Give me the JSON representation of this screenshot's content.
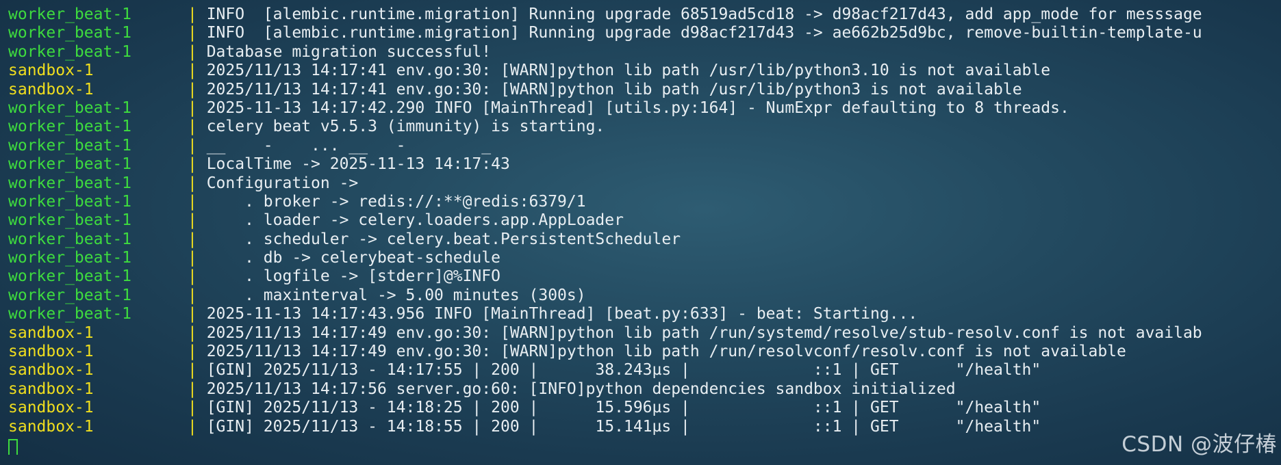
{
  "colors": {
    "worker_beat": "#3edc3e",
    "sandbox": "#f0de1e",
    "separator": "#f0de1e",
    "text": "#e8eef2"
  },
  "separator": "|",
  "lines": [
    {
      "service": "worker_beat-1",
      "color": "green",
      "text": "INFO  [alembic.runtime.migration] Running upgrade 68519ad5cd18 -> d98acf217d43, add app_mode for messsage"
    },
    {
      "service": "worker_beat-1",
      "color": "green",
      "text": "INFO  [alembic.runtime.migration] Running upgrade d98acf217d43 -> ae662b25d9bc, remove-builtin-template-u"
    },
    {
      "service": "worker_beat-1",
      "color": "green",
      "text": "Database migration successful!"
    },
    {
      "service": "sandbox-1",
      "color": "yellow",
      "text": "2025/11/13 14:17:41 env.go:30: [WARN]python lib path /usr/lib/python3.10 is not available"
    },
    {
      "service": "sandbox-1",
      "color": "yellow",
      "text": "2025/11/13 14:17:41 env.go:30: [WARN]python lib path /usr/lib/python3 is not available"
    },
    {
      "service": "worker_beat-1",
      "color": "green",
      "text": "2025-11-13 14:17:42.290 INFO [MainThread] [utils.py:164] - NumExpr defaulting to 8 threads."
    },
    {
      "service": "worker_beat-1",
      "color": "green",
      "text": "celery beat v5.5.3 (immunity) is starting."
    },
    {
      "service": "worker_beat-1",
      "color": "green",
      "text": "__    -    ... __   -        _"
    },
    {
      "service": "worker_beat-1",
      "color": "green",
      "text": "LocalTime -> 2025-11-13 14:17:43"
    },
    {
      "service": "worker_beat-1",
      "color": "green",
      "text": "Configuration ->"
    },
    {
      "service": "worker_beat-1",
      "color": "green",
      "text": "    . broker -> redis://:**@redis:6379/1"
    },
    {
      "service": "worker_beat-1",
      "color": "green",
      "text": "    . loader -> celery.loaders.app.AppLoader"
    },
    {
      "service": "worker_beat-1",
      "color": "green",
      "text": "    . scheduler -> celery.beat.PersistentScheduler"
    },
    {
      "service": "worker_beat-1",
      "color": "green",
      "text": "    . db -> celerybeat-schedule"
    },
    {
      "service": "worker_beat-1",
      "color": "green",
      "text": "    . logfile -> [stderr]@%INFO"
    },
    {
      "service": "worker_beat-1",
      "color": "green",
      "text": "    . maxinterval -> 5.00 minutes (300s)"
    },
    {
      "service": "worker_beat-1",
      "color": "green",
      "text": "2025-11-13 14:17:43.956 INFO [MainThread] [beat.py:633] - beat: Starting..."
    },
    {
      "service": "sandbox-1",
      "color": "yellow",
      "text": "2025/11/13 14:17:49 env.go:30: [WARN]python lib path /run/systemd/resolve/stub-resolv.conf is not availab"
    },
    {
      "service": "sandbox-1",
      "color": "yellow",
      "text": "2025/11/13 14:17:49 env.go:30: [WARN]python lib path /run/resolvconf/resolv.conf is not available"
    },
    {
      "service": "sandbox-1",
      "color": "yellow",
      "text": "[GIN] 2025/11/13 - 14:17:55 | 200 |      38.243µs |             ::1 | GET      \"/health\""
    },
    {
      "service": "sandbox-1",
      "color": "yellow",
      "text": "2025/11/13 14:17:56 server.go:60: [INFO]python dependencies sandbox initialized"
    },
    {
      "service": "sandbox-1",
      "color": "yellow",
      "text": "[GIN] 2025/11/13 - 14:18:25 | 200 |      15.596µs |             ::1 | GET      \"/health\""
    },
    {
      "service": "sandbox-1",
      "color": "yellow",
      "text": "[GIN] 2025/11/13 - 14:18:55 | 200 |      15.141µs |             ::1 | GET      \"/health\""
    }
  ],
  "watermark": "CSDN @波仔椿"
}
